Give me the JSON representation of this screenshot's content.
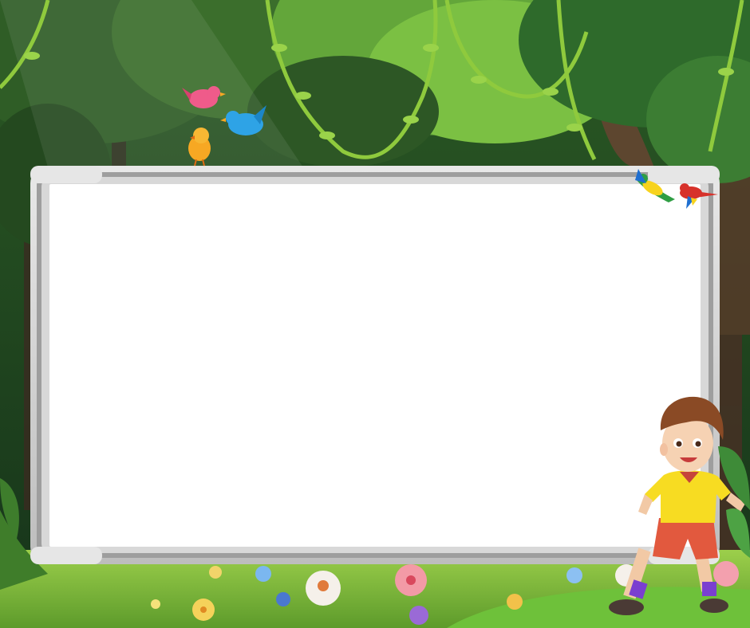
{
  "scene": {
    "colors": {
      "forest_dark": "#1f3f1a",
      "canopy_light": "#7bc043",
      "trunk": "#5a3a2a",
      "grass": "#7fbf3f",
      "board_frame": "#cfcfcf",
      "board_surface": "#ffffff"
    },
    "birds": [
      {
        "kind": "pink-bird",
        "color": "#ef5b8a"
      },
      {
        "kind": "blue-bird",
        "color": "#2ea3e6"
      },
      {
        "kind": "yellow-chick",
        "color": "#f7a823"
      },
      {
        "kind": "green-parrot",
        "color": "#2f9e44"
      },
      {
        "kind": "red-parrot",
        "color": "#d7322b"
      }
    ],
    "character": {
      "kind": "boy",
      "shirt_color": "#f7dc22",
      "shorts_color": "#e2593e"
    }
  }
}
